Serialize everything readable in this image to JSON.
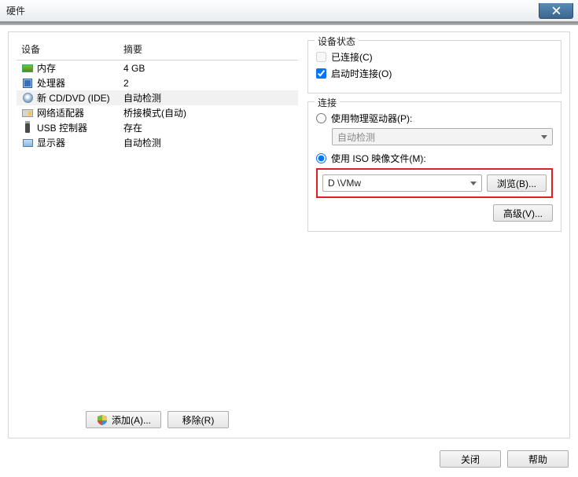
{
  "window": {
    "title": "硬件"
  },
  "devices": {
    "header_device": "设备",
    "header_summary": "摘要",
    "rows": [
      {
        "icon": "memory-icon",
        "name": "内存",
        "summary": "4 GB",
        "selected": false
      },
      {
        "icon": "cpu-icon",
        "name": "处理器",
        "summary": "2",
        "selected": false
      },
      {
        "icon": "disc-icon",
        "name": "新 CD/DVD (IDE)",
        "summary": "自动检测",
        "selected": true
      },
      {
        "icon": "nic-icon",
        "name": "网络适配器",
        "summary": "桥接模式(自动)",
        "selected": false
      },
      {
        "icon": "usb-icon",
        "name": "USB 控制器",
        "summary": "存在",
        "selected": false
      },
      {
        "icon": "monitor-icon",
        "name": "显示器",
        "summary": "自动检测",
        "selected": false
      }
    ],
    "add_label": "添加(A)...",
    "remove_label": "移除(R)"
  },
  "status": {
    "legend": "设备状态",
    "connected_label": "已连接(C)",
    "connected_checked": false,
    "connect_at_poweron_label": "启动时连接(O)",
    "connect_at_poweron_checked": true
  },
  "connection": {
    "legend": "连接",
    "use_physical_label": "使用物理驱动器(P):",
    "use_physical_selected": false,
    "physical_drive_value": "自动检测",
    "use_iso_label": "使用 ISO 映像文件(M):",
    "use_iso_selected": true,
    "iso_path_value": "D                          \\VMw",
    "browse_label": "浏览(B)...",
    "advanced_label": "高级(V)..."
  },
  "footer": {
    "close_label": "关闭",
    "help_label": "帮助"
  }
}
